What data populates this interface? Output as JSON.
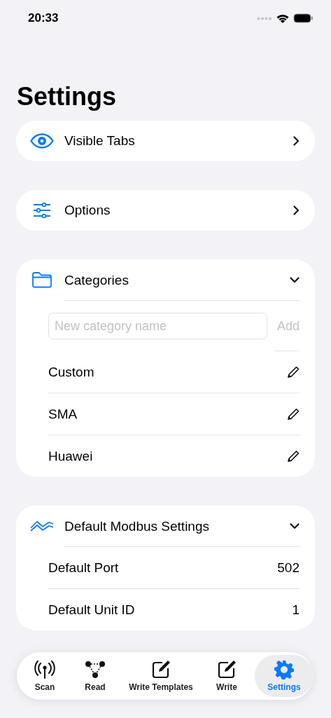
{
  "status_bar": {
    "time": "20:33"
  },
  "title": "Settings",
  "nav_cards": [
    {
      "label": "Visible Tabs"
    },
    {
      "label": "Options"
    }
  ],
  "sections": [
    {
      "kind": "categories",
      "title": "Categories",
      "expanded": true,
      "new_field": {
        "placeholder": "New category name"
      },
      "add_button": {
        "label": "Add",
        "disabled": true
      },
      "items": [
        "Custom",
        "SMA",
        "Huawei"
      ]
    },
    {
      "kind": "values",
      "title": "Default Modbus Settings",
      "expanded": true,
      "rows": [
        {
          "label": "Default Port",
          "value": "502"
        },
        {
          "label": "Default Unit ID",
          "value": "1"
        }
      ]
    }
  ],
  "tab_bar": [
    {
      "label": "Scan",
      "selected": false
    },
    {
      "label": "Read",
      "selected": false
    },
    {
      "label": "Write Templates",
      "selected": false
    },
    {
      "label": "Write",
      "selected": false
    },
    {
      "label": "Settings",
      "selected": true
    }
  ]
}
